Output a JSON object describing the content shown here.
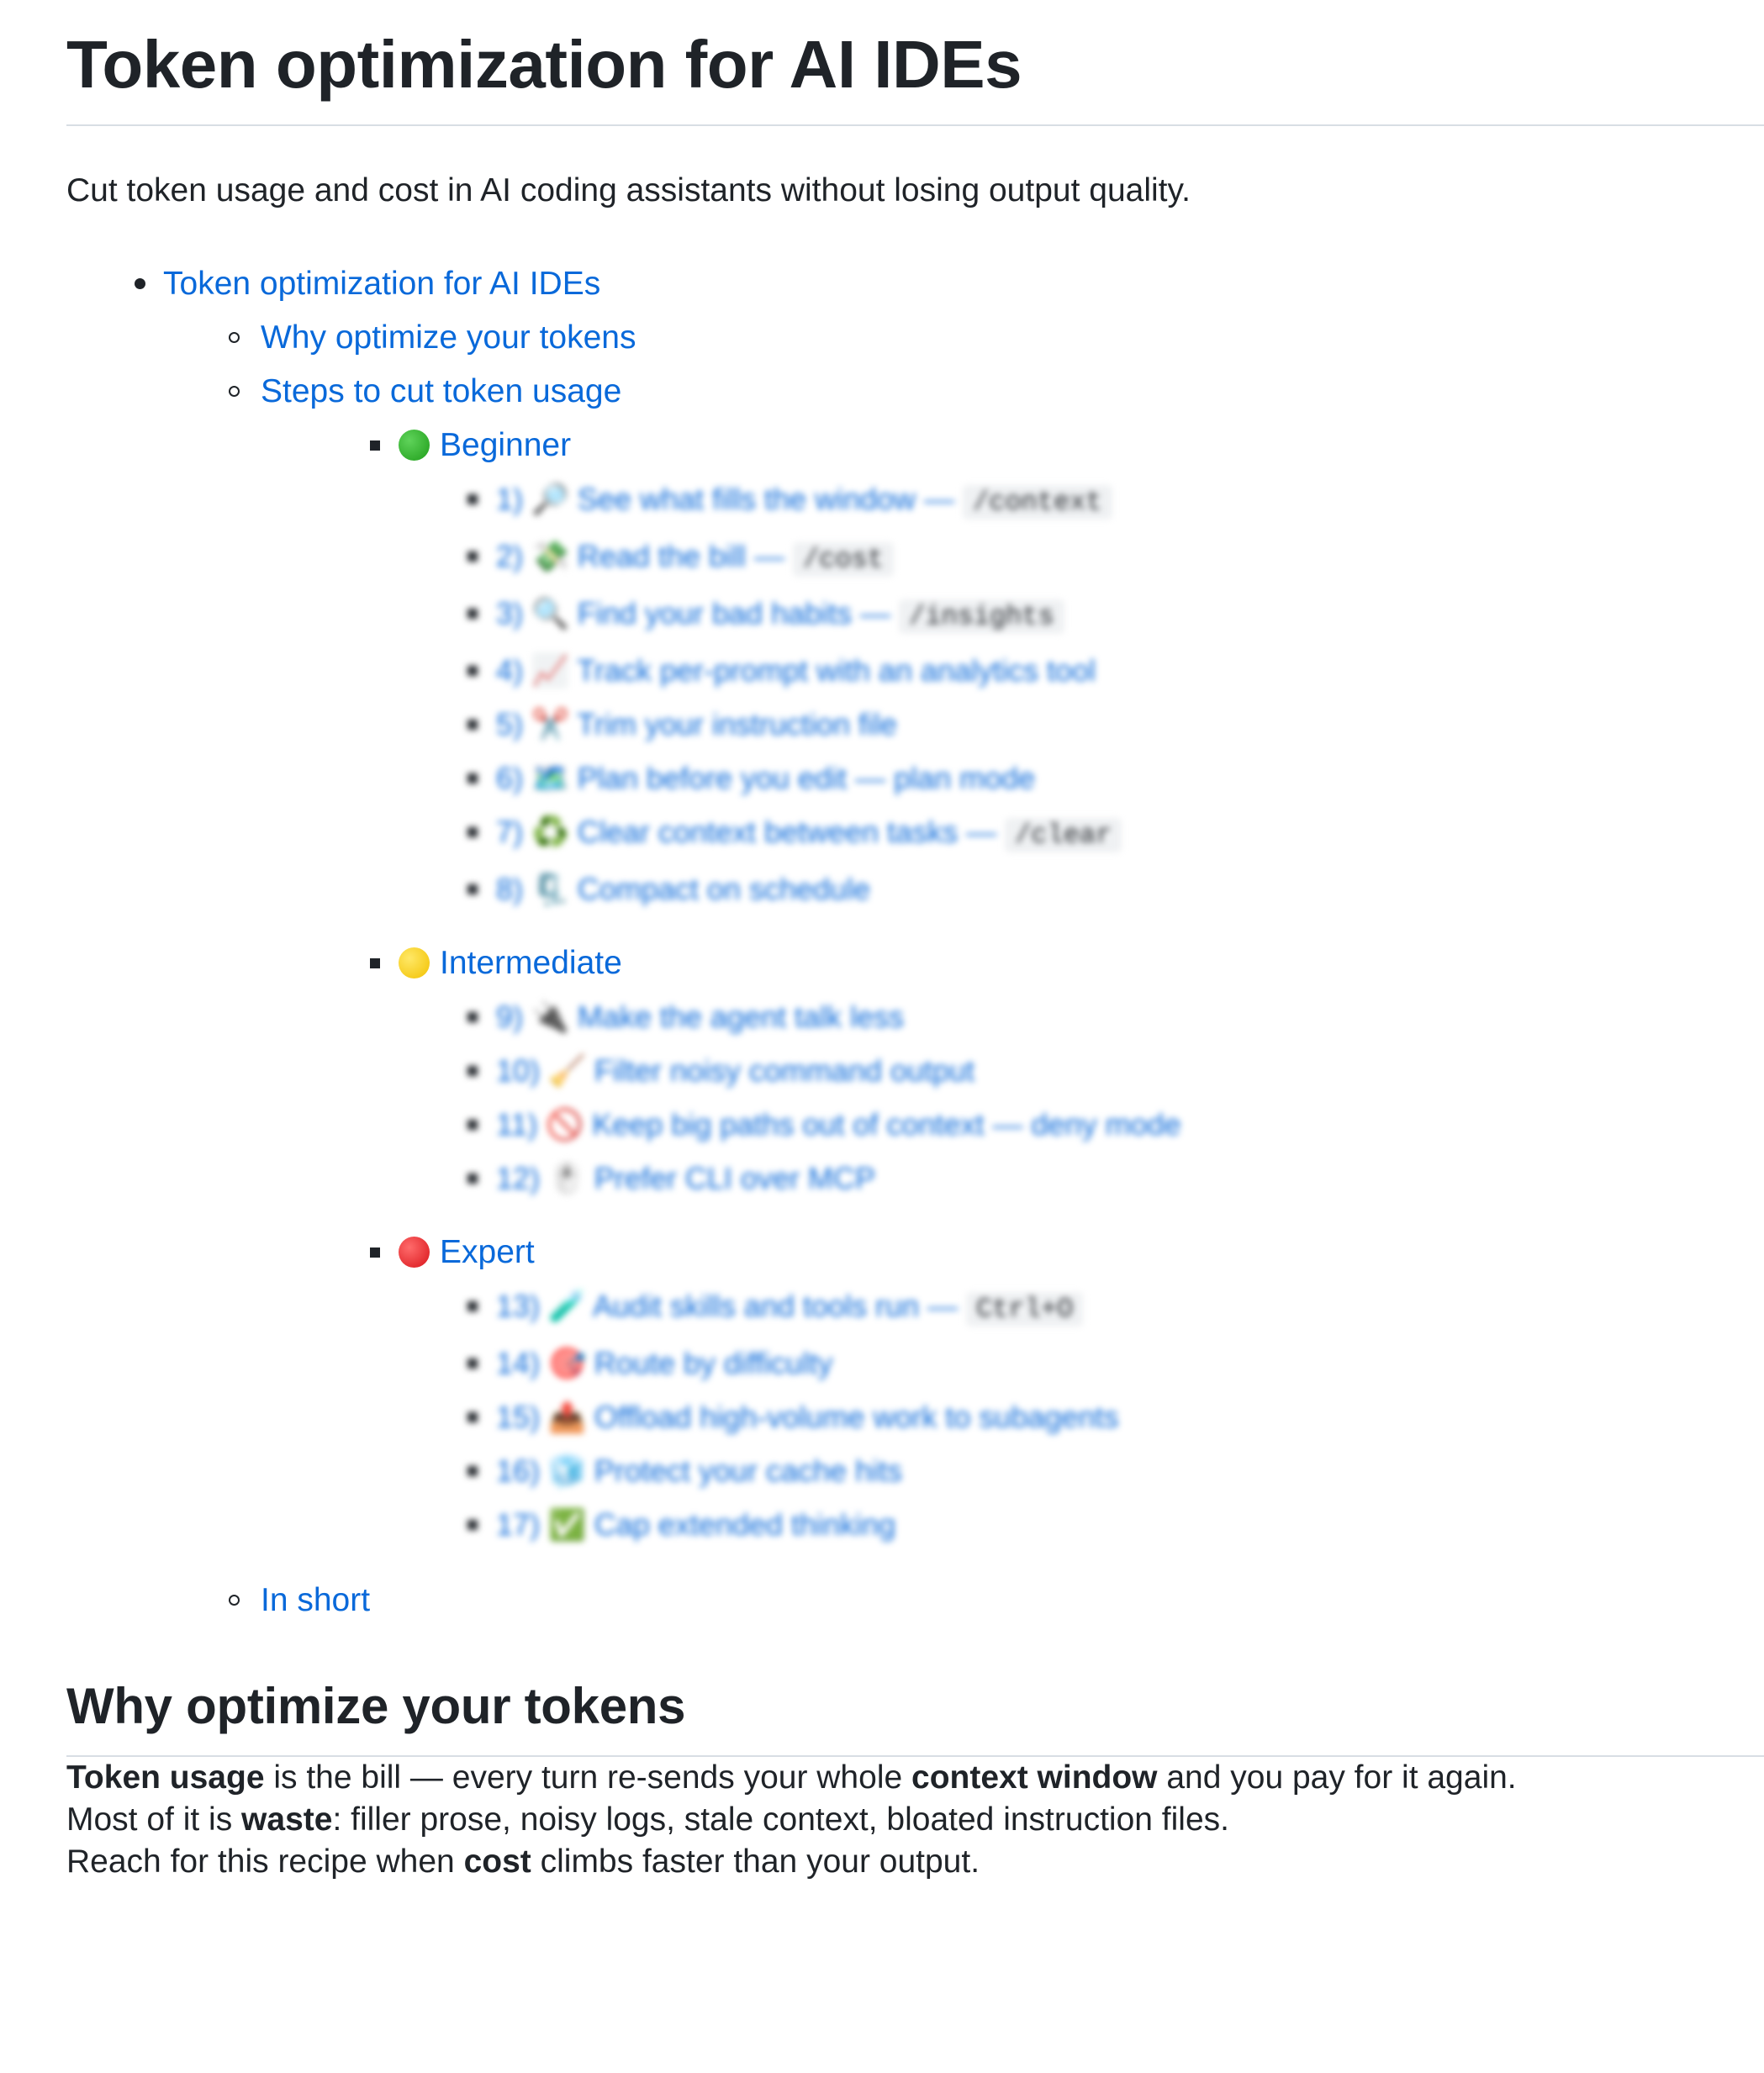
{
  "title": "Token optimization for AI IDEs",
  "intro": "Cut token usage and cost in AI coding assistants without losing output quality.",
  "toc": {
    "root": "Token optimization for AI IDEs",
    "why": "Why optimize your tokens",
    "steps": "Steps to cut token usage",
    "in_short": "In short",
    "levels": [
      {
        "label": "Beginner",
        "color": "#22a81c",
        "items": [
          {
            "text": "1) 🔎 See what fills the window — ",
            "code": "/context"
          },
          {
            "text": "2) 💸 Read the bill — ",
            "code": "/cost"
          },
          {
            "text": "3) 🔍 Find your bad habits — ",
            "code": "/insights"
          },
          {
            "text": "4) 📈 Track per-prompt with an analytics tool",
            "code": ""
          },
          {
            "text": "5) ✂️ Trim your instruction file",
            "code": ""
          },
          {
            "text": "6) 🗺️ Plan before you edit — plan mode",
            "code": ""
          },
          {
            "text": "7) ♻️ Clear context between tasks — ",
            "code": "/clear"
          },
          {
            "text": "8) 🗜️ Compact on schedule",
            "code": ""
          }
        ]
      },
      {
        "label": "Intermediate",
        "color": "#f2c100",
        "items": [
          {
            "text": "9) 🔌 Make the agent talk less",
            "code": ""
          },
          {
            "text": "10) 🧹 Filter noisy command output",
            "code": ""
          },
          {
            "text": "11) 🚫 Keep big paths out of context — deny mode",
            "code": ""
          },
          {
            "text": "12) 🖱️ Prefer CLI over MCP",
            "code": ""
          }
        ]
      },
      {
        "label": "Expert",
        "color": "#d9141a",
        "items": [
          {
            "text": "13) 🧪 Audit skills and tools run — ",
            "code": "Ctrl+O"
          },
          {
            "text": "14) 🎯 Route by difficulty",
            "code": ""
          },
          {
            "text": "15) 📤 Offload high-volume work to subagents",
            "code": ""
          },
          {
            "text": "16) 🧊 Protect your cache hits",
            "code": ""
          },
          {
            "text": "17) ✅ Cap extended thinking",
            "code": ""
          }
        ]
      }
    ]
  },
  "why_section": {
    "heading": "Why optimize your tokens",
    "p1": {
      "b1": "Token usage",
      "t1": " is the bill — every turn re-sends your whole ",
      "b2": "context window",
      "t2": " and you pay for it again."
    },
    "p2": {
      "t0": "Most of it is ",
      "b1": "waste",
      "t1": ": filler prose, noisy logs, stale context, bloated instruction files."
    },
    "p3": {
      "t0": "Reach for this recipe when ",
      "b1": "cost",
      "t1": " climbs faster than your output."
    }
  }
}
